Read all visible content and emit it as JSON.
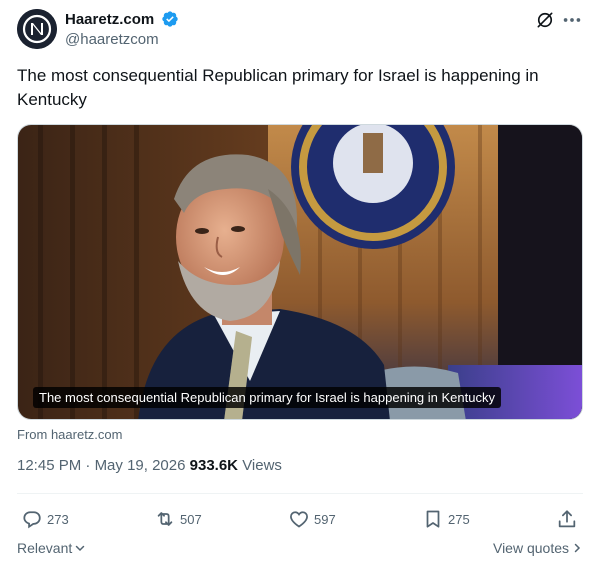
{
  "author": {
    "name": "Haaretz.com",
    "handle": "@haaretzcom"
  },
  "tweet": {
    "text": "The most consequential Republican primary for Israel is happening in Kentucky",
    "media_caption": "The most consequential Republican primary for Israel is happening in Kentucky",
    "source": "From haaretz.com"
  },
  "meta": {
    "time": "12:45 PM",
    "separator": " · ",
    "date": "May 19, 2026",
    "views_count": "933.6K",
    "views_label": "Views"
  },
  "actions": {
    "replies": "273",
    "reposts": "507",
    "likes": "597",
    "bookmarks": "275"
  },
  "footer": {
    "sort_label": "Relevant",
    "quotes_label": "View quotes"
  },
  "colors": {
    "verified": "#1d9bf0",
    "muted": "#536471",
    "text": "#0f1419"
  },
  "icons": {
    "avatar": "haaretz-logo",
    "verified": "verified-badge-icon",
    "grok": "grok-icon",
    "more": "more-icon",
    "reply": "reply-icon",
    "repost": "repost-icon",
    "like": "heart-icon",
    "bookmark": "bookmark-icon",
    "share": "share-icon"
  }
}
